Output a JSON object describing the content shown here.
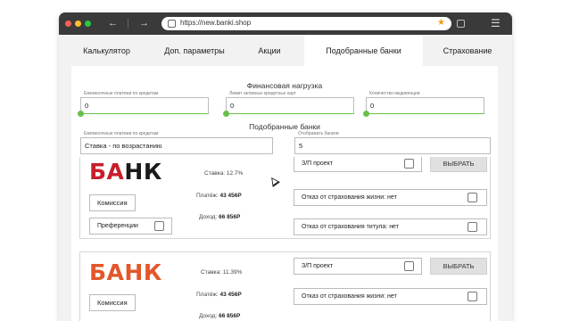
{
  "browser": {
    "url": "https://new.banki.shop",
    "back_icon": "arrow-left-icon",
    "forward_icon": "arrow-right-icon",
    "menu_icon": "hamburger-icon",
    "bookmark_icon": "star-icon"
  },
  "tabs": [
    {
      "label": "Калькулятор"
    },
    {
      "label": "Доп. параметры"
    },
    {
      "label": "Акции"
    },
    {
      "label": "Подобранные банки",
      "active": true
    },
    {
      "label": "Страхование"
    }
  ],
  "financial": {
    "title": "Финансовая нагрузка",
    "fields": [
      {
        "label": "Ежемесячные платежи по кредитам",
        "value": "0"
      },
      {
        "label": "Лимит активных кредитных карт",
        "value": "0"
      },
      {
        "label": "Количество иждивенцев",
        "value": "0"
      }
    ]
  },
  "banks": {
    "title": "Подобранные банки",
    "sort": {
      "label": "Ежемесячные платежи по кредитам",
      "value": "Ставка - по возрастанию"
    },
    "count": {
      "label": "Отображать банков",
      "value": "5"
    },
    "cards": [
      {
        "logo_text_a": "БА",
        "logo_text_b": "НК",
        "rate": "Ставка: 12.7%",
        "payment_label": "Платёж:",
        "payment_value": "43 456Р",
        "income_label": "Доход:",
        "income_value": "66 856Р",
        "commission": "Комиссия",
        "preferences": "Преференции",
        "zp_project": "З/П проект",
        "select": "ВЫБРАТЬ",
        "life_insurance": "Отказ от страхования жизни: нет",
        "title_insurance": "Отказ от страхования титула: нет"
      },
      {
        "logo_text_a": "БА",
        "logo_text_b": "НК",
        "rate": "Ставка: 11.39%",
        "payment_label": "Платёж:",
        "payment_value": "43 456Р",
        "income_label": "Доход:",
        "income_value": "66 856Р",
        "commission": "Комиссия",
        "zp_project": "З/П проект",
        "select": "ВЫБРАТЬ",
        "life_insurance": "Отказ от страхования жизни: нет"
      }
    ]
  },
  "colors": {
    "accent_green": "#6abf4b",
    "bank1_logo_red": "#c81e2c",
    "bank2_logo_orange": "#e2572b"
  }
}
